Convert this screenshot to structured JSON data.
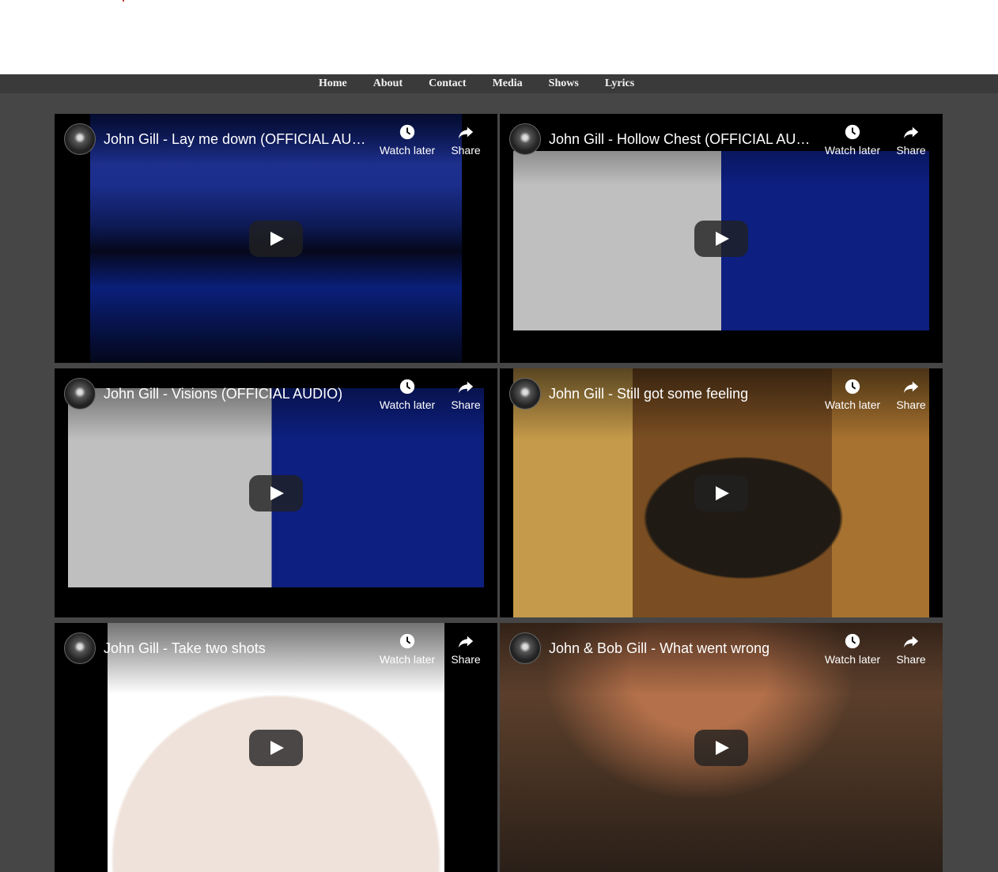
{
  "nav": [
    "Home",
    "About",
    "Contact",
    "Media",
    "Shows",
    "Lyrics"
  ],
  "controls": {
    "watch_later": "Watch later",
    "share": "Share"
  },
  "videos": [
    {
      "title": "John Gill - Lay me down (OFFICIAL AUDIO)"
    },
    {
      "title": "John Gill - Hollow Chest (OFFICIAL AUDIO)"
    },
    {
      "title": "John Gill - Visions (OFFICIAL AUDIO)"
    },
    {
      "title": "John Gill - Still got some feeling"
    },
    {
      "title": "John Gill - Take two shots"
    },
    {
      "title": "John & Bob Gill - What went wrong"
    }
  ]
}
